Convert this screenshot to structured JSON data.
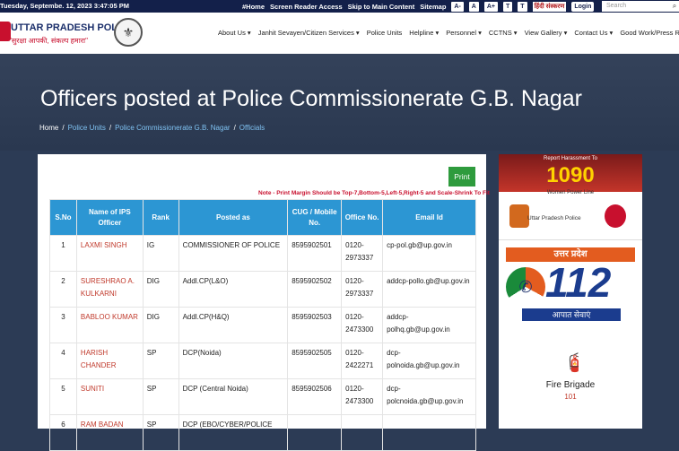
{
  "topbar": {
    "date": "Tuesday, Septembe. 12, 2023 3:47:05 PM",
    "links": [
      "#Home",
      "Screen Reader Access",
      "Skip to Main Content",
      "Sitemap"
    ],
    "font_buttons": [
      "A-",
      "A",
      "A+",
      "T",
      "T"
    ],
    "hindi_label": "हिंदी संस्करण",
    "login_label": "Login",
    "search_placeholder": "Search"
  },
  "header": {
    "logo_title": "UTTAR PRADESH POLICE",
    "logo_tagline": "\"सुरक्षा आपकी, संकल्प हमारा\"",
    "nav": [
      "About Us ▾",
      "Janhit Sevayen/Citizen Services ▾",
      "Police Units",
      "Helpline ▾",
      "Personnel ▾",
      "CCTNS ▾",
      "View Gallery ▾",
      "Contact Us ▾",
      "Good Work/Press Releas"
    ]
  },
  "hero": {
    "title": "Officers posted at Police Commissionerate G.B. Nagar",
    "breadcrumb": [
      "Home",
      "Police Units",
      "Police Commissionerate G.B. Nagar",
      "Officials"
    ]
  },
  "content": {
    "print_label": "Print",
    "note": "Note - Print Margin Should be Top-7,Bottom-5,Left-5,Right-5 and Scale-Shrink To Fit",
    "columns": [
      "S.No",
      "Name of IPS Officer",
      "Rank",
      "Posted as",
      "CUG / Mobile No.",
      "Office No.",
      "Email Id"
    ],
    "rows": [
      {
        "sno": "1",
        "name": "LAXMI SINGH",
        "rank": "IG",
        "posted": "COMMISSIONER OF POLICE",
        "cug": "8595902501",
        "office": "0120-2973337",
        "email": "cp-pol.gb@up.gov.in"
      },
      {
        "sno": "2",
        "name": "SURESHRAO A. KULKARNI",
        "rank": "DIG",
        "posted": "Addl.CP(L&O)",
        "cug": "8595902502",
        "office": "0120-2973337",
        "email": "addcp-pollo.gb@up.gov.in"
      },
      {
        "sno": "3",
        "name": "BABLOO KUMAR",
        "rank": "DIG",
        "posted": "Addl.CP(H&Q)",
        "cug": "8595902503",
        "office": "0120-2473300",
        "email": "addcp-polhq.gb@up.gov.in"
      },
      {
        "sno": "4",
        "name": "HARISH CHANDER",
        "rank": "SP",
        "posted": "DCP(Noida)",
        "cug": "8595902505",
        "office": "0120-2422271",
        "email": "dcp-polnoida.gb@up.gov.in"
      },
      {
        "sno": "5",
        "name": "SUNITI",
        "rank": "SP",
        "posted": "DCP (Central Noida)",
        "cug": "8595902506",
        "office": "0120-2473300",
        "email": "dcp-polcnoida.gb@up.gov.in"
      },
      {
        "sno": "6",
        "name": "RAM BADAN",
        "rank": "SP",
        "posted": "DCP (EBO/CYBER/POLICE",
        "cug": "",
        "office": "",
        "email": ""
      }
    ]
  },
  "sidebar": {
    "b1090": {
      "caption": "Report Harassment To",
      "number": "1090",
      "sub": "Women Power Line",
      "org": "Uttar Pradesh Police"
    },
    "b112": {
      "state": "उत्तर प्रदेश",
      "number": "112",
      "service": "आपात सेवाएं"
    },
    "fire": {
      "label": "Fire Brigade",
      "number": "101"
    }
  },
  "colors": {
    "table_header": "#2c96d3",
    "name_text": "#c0392b",
    "print_button": "#2e9b3d",
    "topbar": "#13204a"
  }
}
